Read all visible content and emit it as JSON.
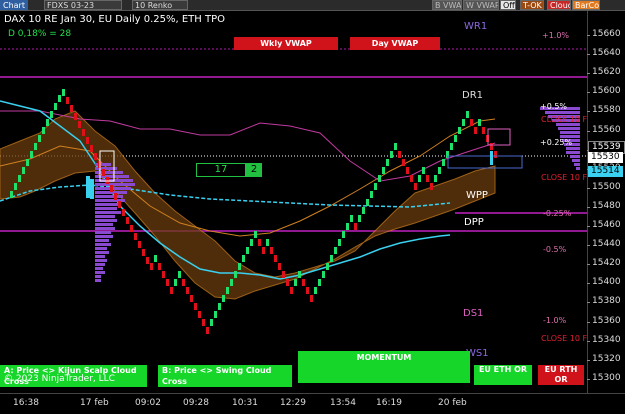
{
  "toolbar": {
    "chart_label": "Chart",
    "instrument": "FDXS 03-23",
    "bar_type": "10 Renko",
    "b_vwap": "B VWAP",
    "w_vwap": "W VWAP",
    "off": "Off",
    "tok": "T-OK",
    "cloud": "Cloud",
    "barcol": "BarCol"
  },
  "header": {
    "title": "DAX 10  RE Jan 30, EU Daily 0.25%, ETH TPO",
    "delta": "D 0,18% = 28"
  },
  "buttons": {
    "weekly_vwap": "Wkly VWAP",
    "day_vwap": "Day VWAP",
    "momentum": "MOMENTUM",
    "kijun": "A: Price <> Kijun Scalp Cloud Cross",
    "swing": "B: Price <> Swing Cloud Cross",
    "eu_eth": "EU ETH OR",
    "eu_rth": "EU RTH OR"
  },
  "copyright": "© 2023 NinjaTrader, LLC",
  "levels": {
    "wr1": "WR1",
    "dr1": "DR1",
    "wpp": "WPP",
    "dpp": "DPP",
    "ds1": "DS1",
    "ws1": "WS1",
    "pct_p1": "+1.0%",
    "pct_p05": "+0.5%",
    "pct_p025": "+0.25%",
    "pct_m025": "-0.25%",
    "pct_m05": "-0.5%",
    "pct_m1": "-1.0%",
    "close_p": "CLOSE 10 F",
    "close_mid": "CLOSE 10 F",
    "close_bottom": "CLOSE 10 F"
  },
  "counter": {
    "left": "17",
    "right": "2"
  },
  "yaxis": {
    "ticks": [
      "15660",
      "15640",
      "15620",
      "15600",
      "15580",
      "15560",
      "15540",
      "15520",
      "15500",
      "15480",
      "15460",
      "15440",
      "15420",
      "15400",
      "15380",
      "15360",
      "15340",
      "15320",
      "15300"
    ],
    "price_upper": "15539",
    "price_current": "15530",
    "price_lower": "15514"
  },
  "xaxis": {
    "ticks": [
      "16:38",
      "17 feb",
      "09:02",
      "09:28",
      "10:31",
      "12:29",
      "13:54",
      "16:19",
      "20 feb"
    ]
  },
  "colors": {
    "up": "#1ee06a",
    "down": "#e0101a",
    "orange_cloud": "#c8781e",
    "magenta": "#c020c0",
    "cyan": "#3ad0f0"
  }
}
